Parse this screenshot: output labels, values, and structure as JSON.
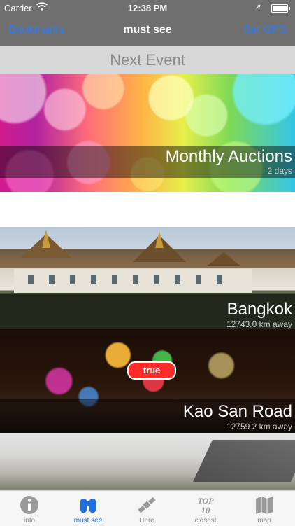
{
  "status_bar": {
    "carrier": "Carrier",
    "time": "12:38 PM"
  },
  "nav": {
    "left_label": "Bookmarks",
    "title": "must see",
    "right_label": "Set GPS"
  },
  "section": {
    "header": "Next Event"
  },
  "event": {
    "title": "Monthly Auctions",
    "subtitle": "2 days"
  },
  "places": [
    {
      "title": "Bangkok",
      "subtitle": "12743.0 km away"
    },
    {
      "title": "Kao San Road",
      "subtitle": "12759.2 km away"
    }
  ],
  "sign_text": "true",
  "tabs": [
    {
      "label": "info",
      "icon": "info-icon"
    },
    {
      "label": "must see",
      "icon": "binoculars-icon",
      "active": true
    },
    {
      "label": "Here",
      "icon": "satellite-icon"
    },
    {
      "label": "closest",
      "icon": "top10-icon"
    },
    {
      "label": "map",
      "icon": "map-icon"
    }
  ],
  "colors": {
    "accent": "#2f7cf6",
    "active_tab": "#1f6fe0",
    "bar": "#6f6f6f"
  }
}
